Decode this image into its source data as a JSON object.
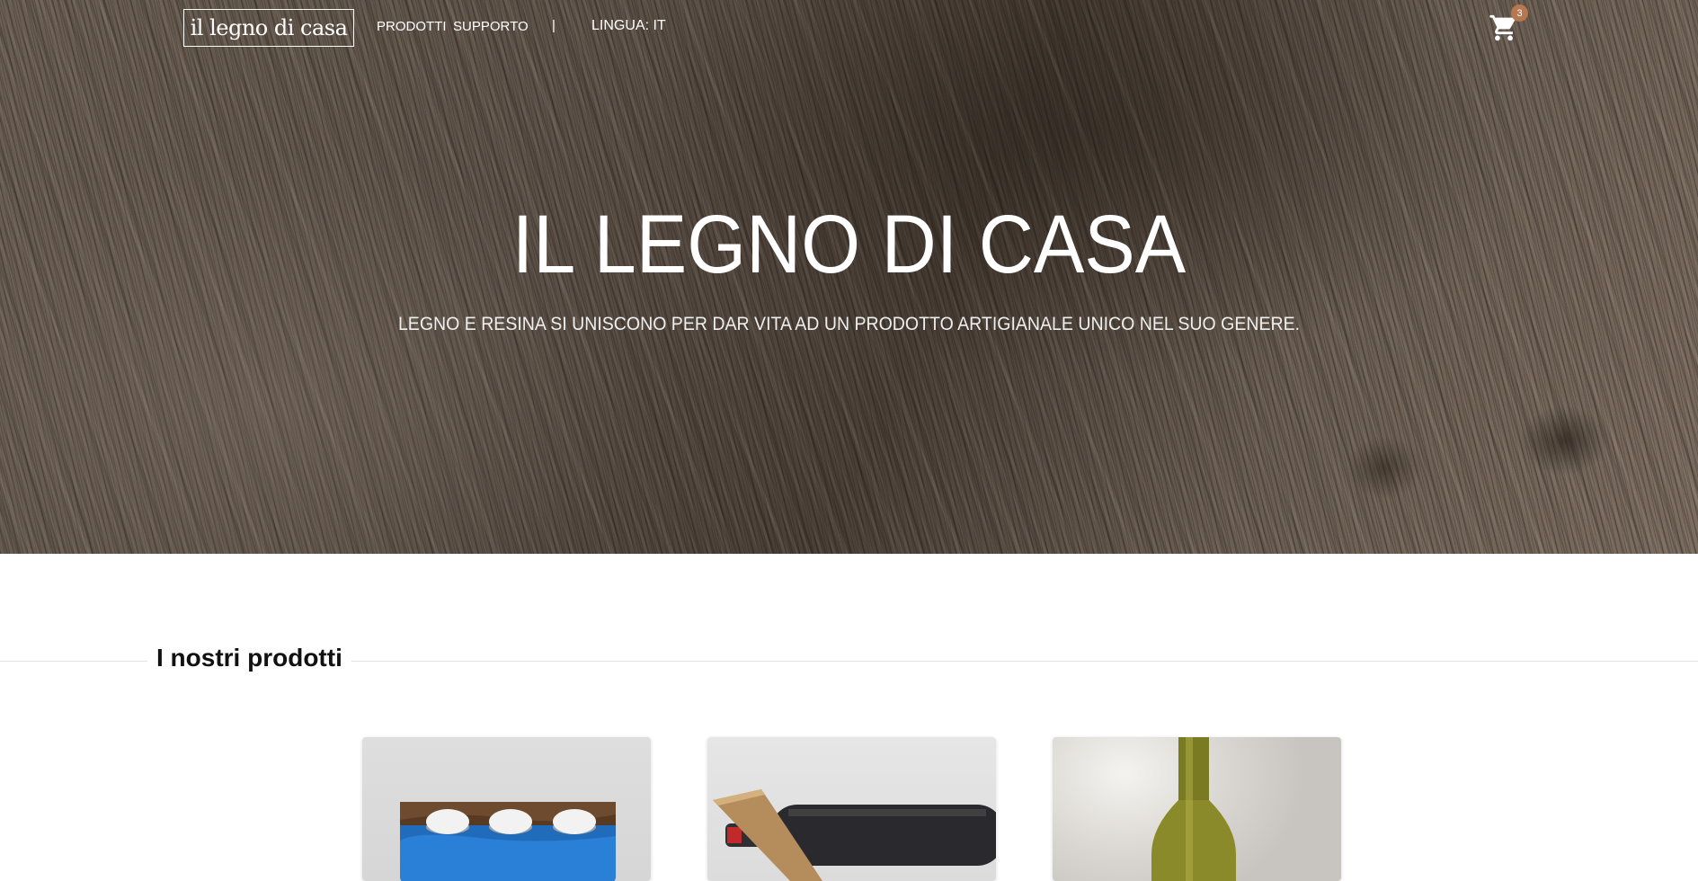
{
  "nav": {
    "logo": "il legno di casa",
    "links": [
      "PRODOTTI",
      "SUPPORTO"
    ],
    "separator": "|",
    "language": "LINGUA: IT",
    "cart_icon": "cart-icon",
    "cart_count": "3"
  },
  "hero": {
    "title": "IL LEGNO DI CASA",
    "subtitle": "LEGNO E RESINA SI UNISCONO PER DAR VITA AD UN PRODOTTO ARTIGIANALE UNICO NEL SUO GENERE."
  },
  "products_section": {
    "title": "I nostri prodotti",
    "products": [
      {
        "image": "candle-holder-image"
      },
      {
        "image": "wine-holder-image"
      },
      {
        "image": "bottle-lamp-image"
      }
    ]
  },
  "colors": {
    "badge": "#b7774f",
    "resin_blue": "#1f72c8",
    "wood": "#6b5e52"
  }
}
